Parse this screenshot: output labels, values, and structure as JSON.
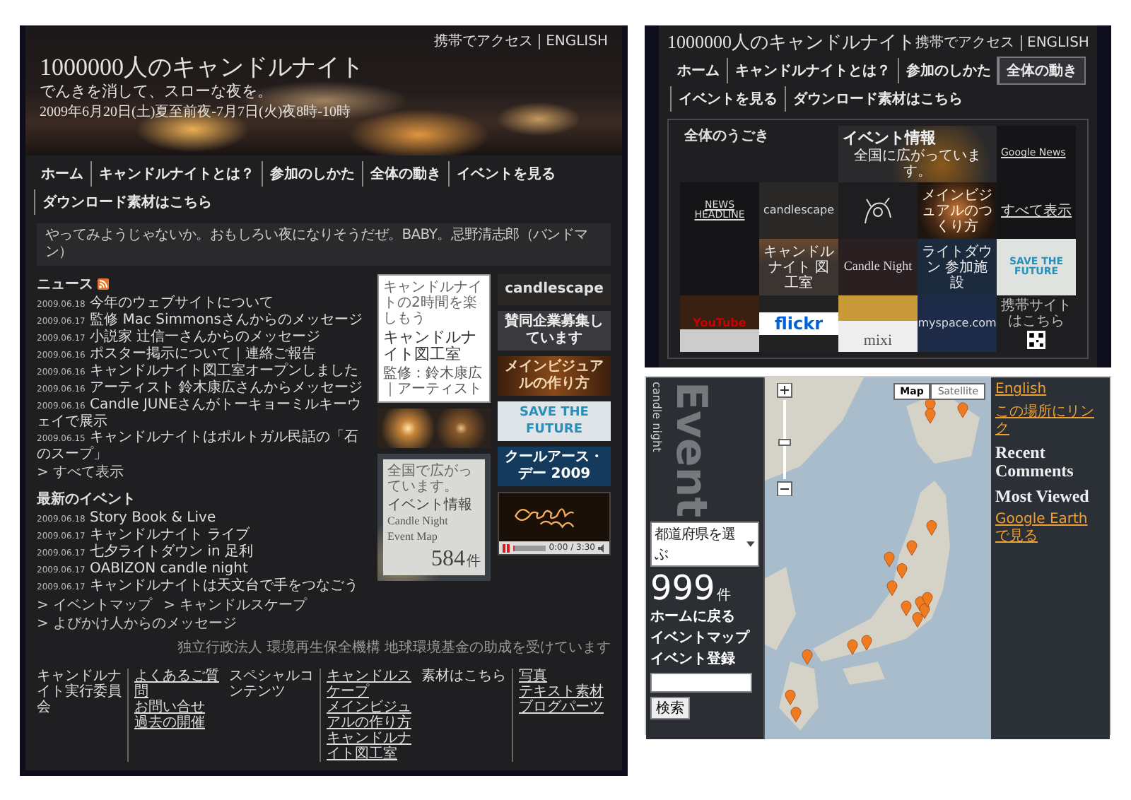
{
  "main_site": {
    "access_links": [
      "携帯でアクセス",
      "ENGLISH"
    ],
    "title": "1000000人のキャンドルナイト",
    "tagline": "でんきを消して、スローな夜を。",
    "dates": "2009年6月20日(土)夏至前夜-7月7日(火)夜8時-10時",
    "nav": [
      {
        "label": "ホーム",
        "selected": false
      },
      {
        "label": "キャンドルナイトとは？",
        "selected": false
      },
      {
        "label": "参加のしかた",
        "selected": false
      },
      {
        "label": "全体の動き",
        "selected": false
      },
      {
        "label": "イベントを見る",
        "selected": false
      },
      {
        "label": "ダウンロード素材はこちら",
        "selected": false
      }
    ],
    "ticker": "やってみようじゃないか。おもしろい夜になりそうだぜ。BABY。忌野清志郎（バンドマン）",
    "news": {
      "title": "ニュース",
      "items": [
        {
          "date": "2009.06.18",
          "text": "今年のウェブサイトについて"
        },
        {
          "date": "2009.06.17",
          "text": "監修 Mac Simmonsさんからのメッセージ"
        },
        {
          "date": "2009.06.17",
          "text": "小説家 辻信一さんからのメッセージ"
        },
        {
          "date": "2009.06.16",
          "text": "ポスター掲示について｜連絡ご報告"
        },
        {
          "date": "2009.06.16",
          "text": "キャンドルナイト図工室オープンしました"
        },
        {
          "date": "2009.06.16",
          "text": "アーティスト 鈴木康広さんからメッセージ"
        },
        {
          "date": "2009.06.16",
          "text": "Candle JUNEさんがトーキョーミルキーウェイで展示"
        },
        {
          "date": "2009.06.15",
          "text": "キャンドルナイトはポルトガル民話の「石のスープ」"
        }
      ],
      "more": "> すべて表示"
    },
    "events": {
      "title": "最新のイベント",
      "items": [
        {
          "date": "2009.06.18",
          "text": "Story Book & Live"
        },
        {
          "date": "2009.06.17",
          "text": "キャンドルナイト ライブ"
        },
        {
          "date": "2009.06.17",
          "text": "七夕ライトダウン in 足利"
        },
        {
          "date": "2009.06.17",
          "text": "OABIZON candle night"
        },
        {
          "date": "2009.06.17",
          "text": "キャンドルナイトは天文台で手をつなごう"
        }
      ],
      "links": [
        "> イベントマップ",
        "> キャンドルスケープ",
        "> よびかけ人からのメッセージ"
      ]
    },
    "workshop": {
      "kicker": "キャンドルナイトの2時間を楽しもう",
      "title": "キャンドルナイト図工室",
      "credit": "監修：鈴木康広｜アーティスト"
    },
    "event_map": {
      "kicker": "全国で広がっています。",
      "title": "イベント情報",
      "subtitle_lines": [
        "Candle Night",
        "Event Map"
      ],
      "count": "584",
      "unit": "件"
    },
    "banners": [
      {
        "kind": "logo",
        "label": "candlescape"
      },
      {
        "kind": "sparkle",
        "label": "賛同企業募集しています"
      },
      {
        "kind": "glow",
        "label": "メインビジュアルの作り方"
      },
      {
        "kind": "future",
        "label": "SAVE THE FUTURE"
      },
      {
        "kind": "night",
        "label": "クールアース・デー 2009"
      }
    ],
    "video": {
      "playing": true,
      "level": 0.04,
      "time": "0:00 / 3:30"
    },
    "grant_note": "独立行政法人 環境再生保全機構 地球環境基金の助成を受けています",
    "footer": [
      {
        "heading": "キャンドルナイト実行委員会",
        "links": [
          "よくあるご質問",
          "お問い合せ",
          "過去の開催"
        ]
      },
      {
        "heading": "スペシャルコンテンツ",
        "links": [
          "キャンドルスケープ",
          "メインビジュアルの作り方",
          "キャンドルナイト図工室"
        ]
      },
      {
        "heading": "素材はこちら",
        "links": [
          "写真",
          "テキスト素材",
          "ブログパーツ"
        ]
      }
    ]
  },
  "overview_page": {
    "access_links": [
      "携帯でアクセス",
      "ENGLISH"
    ],
    "title": "1000000人のキャンドルナイト",
    "nav": [
      {
        "label": "ホーム",
        "selected": false
      },
      {
        "label": "キャンドルナイトとは？",
        "selected": false
      },
      {
        "label": "参加のしかた",
        "selected": false
      },
      {
        "label": "全体の動き",
        "selected": true
      },
      {
        "label": "イベントを見る",
        "selected": false
      },
      {
        "label": "ダウンロード素材はこちら",
        "selected": false
      }
    ],
    "tiles": [
      {
        "kind": "heading",
        "label": "全体のうごき"
      },
      {
        "kind": "feature",
        "label": "イベント情報",
        "sub": "全国に広がっています。"
      },
      {
        "kind": "news",
        "label": "Google News"
      },
      {
        "kind": "news",
        "label": "NEWS HEADLINE"
      },
      {
        "kind": "logo",
        "label": "candlescape"
      },
      {
        "kind": "sketch"
      },
      {
        "kind": "glow",
        "label": "メインビジュアルのつくり方"
      },
      {
        "kind": "link",
        "label": "すべて表示"
      },
      {
        "kind": "blank"
      },
      {
        "kind": "candle",
        "label": "キャンドルナイト 図工室"
      },
      {
        "kind": "dark",
        "label": "Candle Night"
      },
      {
        "kind": "sketchblue",
        "label": "ライトダウン 参加施設"
      },
      {
        "kind": "future",
        "label": "SAVE THE FUTURE"
      },
      {
        "kind": "video",
        "label": "YouTube"
      },
      {
        "kind": "flickr",
        "label": "flickr"
      },
      {
        "kind": "mixi",
        "label": "mixi"
      },
      {
        "kind": "myspace",
        "label": "myspace.com"
      },
      {
        "kind": "qr",
        "label": "携帯サイトはこちら"
      }
    ]
  },
  "map_page": {
    "brand": "candle night",
    "heading": "Event",
    "prefecture_select": "都道府県を選ぶ",
    "count": "999",
    "unit": "件",
    "links": [
      "ホームに戻る",
      "イベントマップ",
      "イベント登録"
    ],
    "search_button": "検索",
    "map_types": [
      {
        "label": "Map",
        "selected": true
      },
      {
        "label": "Satellite",
        "selected": false
      }
    ],
    "top_links": [
      "English",
      "この場所にリンク"
    ],
    "sections": [
      "Recent Comments",
      "Most Viewed"
    ],
    "earth_link": "Google Earth で見る"
  }
}
